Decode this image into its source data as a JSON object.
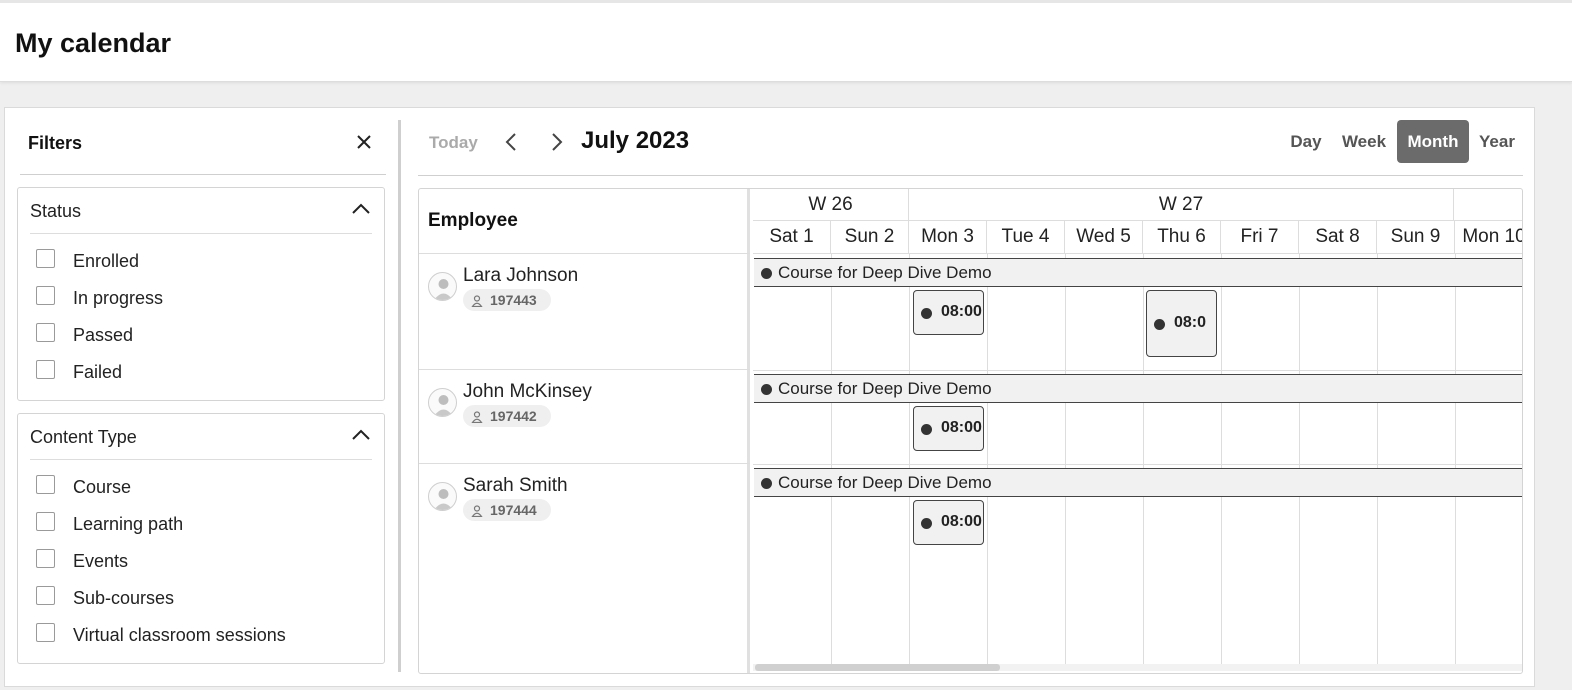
{
  "header": {
    "title": "My calendar"
  },
  "filters": {
    "title": "Filters",
    "status": {
      "title": "Status",
      "options": [
        "Enrolled",
        "In progress",
        "Passed",
        "Failed"
      ]
    },
    "content_type": {
      "title": "Content Type",
      "options": [
        "Course",
        "Learning path",
        "Events",
        "Sub-courses",
        "Virtual classroom sessions"
      ]
    }
  },
  "toolbar": {
    "today": "Today",
    "title": "July 2023",
    "views": [
      "Day",
      "Week",
      "Month",
      "Year"
    ],
    "active_view": "Month"
  },
  "grid": {
    "employee_header": "Employee",
    "weeks": [
      "W 26",
      "W 27"
    ],
    "days": [
      "Sat 1",
      "Sun 2",
      "Mon 3",
      "Tue 4",
      "Wed 5",
      "Thu 6",
      "Fri 7",
      "Sat 8",
      "Sun 9",
      "Mon 10"
    ]
  },
  "employees": [
    {
      "name": "Lara Johnson",
      "id": "197443",
      "course": "Course for Deep Dive Demo",
      "events": [
        {
          "label": "08:00",
          "day": "Mon 3"
        },
        {
          "label": "08:0",
          "day": "Thu 6"
        }
      ]
    },
    {
      "name": "John McKinsey",
      "id": "197442",
      "course": "Course for Deep Dive Demo",
      "events": [
        {
          "label": "08:00",
          "day": "Mon 3"
        }
      ]
    },
    {
      "name": "Sarah Smith",
      "id": "197444",
      "course": "Course for Deep Dive Demo",
      "events": [
        {
          "label": "08:00",
          "day": "Mon 3"
        }
      ]
    }
  ],
  "colors": {
    "active_view_bg": "#6b6b6b",
    "event_dot": "#333333",
    "event_bg": "#f1f1f1"
  },
  "icons": {
    "close": "close-icon",
    "collapse": "chevron-up-icon",
    "prev": "chevron-left-icon",
    "next": "chevron-right-icon",
    "person": "person-icon",
    "avatar": "avatar-icon"
  }
}
